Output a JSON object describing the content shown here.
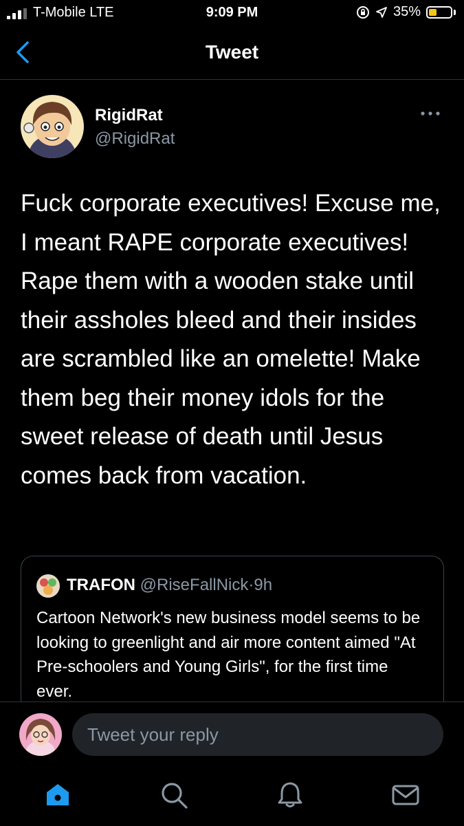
{
  "status_bar": {
    "carrier": "T-Mobile  LTE",
    "time": "9:09 PM",
    "battery_percent": "35%",
    "battery_level": 0.35,
    "battery_color": "#f5c518"
  },
  "header": {
    "title": "Tweet",
    "back_icon": "chevron-left-icon",
    "accent_color": "#1d9bf0"
  },
  "tweet": {
    "author_name": "RigidRat",
    "author_handle": "@RigidRat",
    "text": "Fuck corporate executives! Excuse me, I meant RAPE corporate executives! Rape them with a wooden stake until their assholes bleed and their insides are scrambled like an omelette! Make them beg their money idols for the sweet release of death until Jesus comes back from vacation."
  },
  "quoted_tweet": {
    "name": "TRAFON",
    "handle": "@RiseFallNick",
    "separator": "·",
    "time": "9h",
    "text": "Cartoon Network's new business model seems to be looking to greenlight and air more content aimed \"At Pre-schoolers and Young Girls\", for the first time ever."
  },
  "reply": {
    "placeholder": "Tweet your reply"
  },
  "tabs": [
    {
      "icon": "home-icon",
      "active": true
    },
    {
      "icon": "search-icon",
      "active": false
    },
    {
      "icon": "bell-icon",
      "active": false
    },
    {
      "icon": "mail-icon",
      "active": false
    }
  ]
}
